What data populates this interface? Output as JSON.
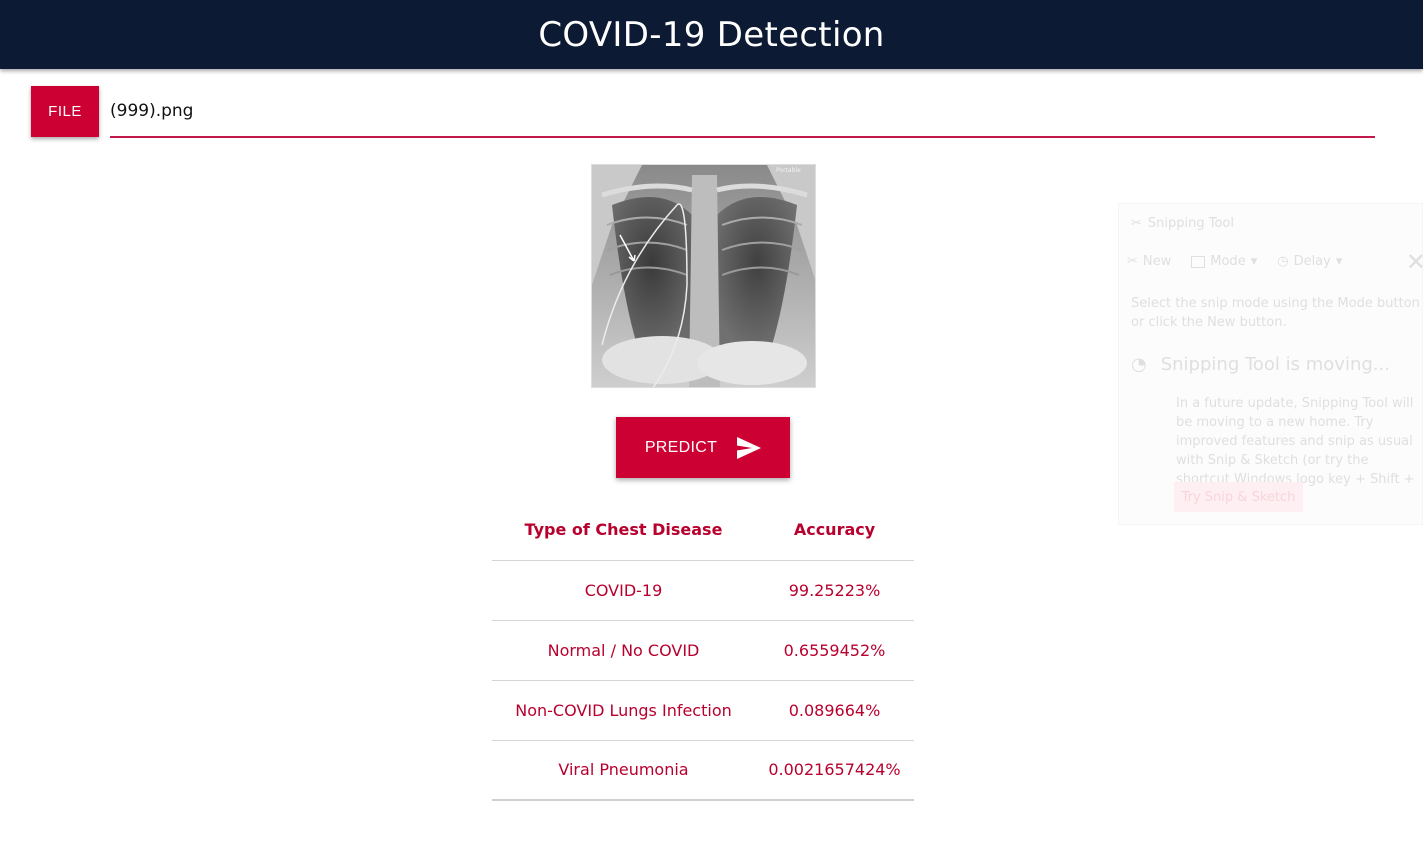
{
  "header": {
    "title": "COVID-19 Detection"
  },
  "upload": {
    "file_button": "FILE",
    "file_name": "(999).png"
  },
  "image": {
    "corner_label": "Portable",
    "icon": "chest-xray-image"
  },
  "predict": {
    "label": "PREDICT",
    "icon": "send-icon"
  },
  "results": {
    "headers": [
      "Type of Chest Disease",
      "Accuracy"
    ],
    "rows": [
      {
        "type": "COVID-19",
        "accuracy": "99.25223%"
      },
      {
        "type": "Normal / No COVID",
        "accuracy": "0.6559452%"
      },
      {
        "type": "Non-COVID Lungs Infection",
        "accuracy": "0.089664%"
      },
      {
        "type": "Viral Pneumonia",
        "accuracy": "0.0021657424%"
      }
    ]
  },
  "background_window": {
    "title": "Snipping Tool",
    "toolbar": [
      "New",
      "Mode",
      "Delay"
    ],
    "hint": "Select the snip mode using the Mode button or click the New button.",
    "heading": "Snipping Tool is moving...",
    "body": "In a future update, Snipping Tool will be moving to a new home. Try improved features and snip as usual with Snip & Sketch (or try the shortcut Windows logo key + Shift + S).",
    "link": "Try Snip & Sketch"
  },
  "colors": {
    "accent": "#cc0033",
    "header_bg": "#0c1a33",
    "text_accent": "#b8002e"
  }
}
